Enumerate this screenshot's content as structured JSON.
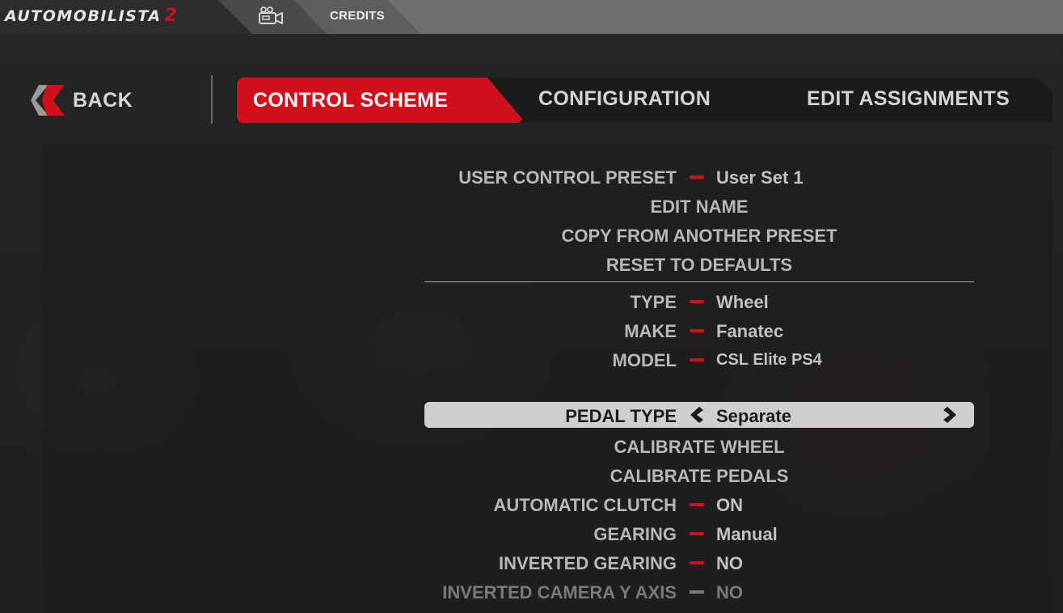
{
  "topbar": {
    "logo_text": "AUTOMOBILISTA",
    "logo_number": "2",
    "camera_icon": "video-camera-icon",
    "credits_label": "CREDITS"
  },
  "nav": {
    "back_label": "BACK",
    "back_icon": "chevron-left-icon",
    "tabs": [
      {
        "label": "CONTROL SCHEME",
        "active": true
      },
      {
        "label": "CONFIGURATION",
        "active": false
      },
      {
        "label": "EDIT ASSIGNMENTS",
        "active": false
      }
    ]
  },
  "settings": {
    "user_control_preset": {
      "label": "USER CONTROL PRESET",
      "value": "User Set 1"
    },
    "edit_name": "EDIT NAME",
    "copy_from_preset": "COPY FROM ANOTHER PRESET",
    "reset_defaults": "RESET TO DEFAULTS",
    "type": {
      "label": "TYPE",
      "value": "Wheel"
    },
    "make": {
      "label": "MAKE",
      "value": "Fanatec"
    },
    "model": {
      "label": "MODEL",
      "value": "CSL Elite PS4"
    },
    "pedal_type": {
      "label": "PEDAL TYPE",
      "value": "Separate"
    },
    "calibrate_wheel": "CALIBRATE WHEEL",
    "calibrate_pedals": "CALIBRATE PEDALS",
    "automatic_clutch": {
      "label": "AUTOMATIC CLUTCH",
      "value": "ON"
    },
    "gearing": {
      "label": "GEARING",
      "value": "Manual"
    },
    "inverted_gearing": {
      "label": "INVERTED GEARING",
      "value": "NO"
    },
    "inverted_camera_y": {
      "label": "INVERTED CAMERA Y AXIS",
      "value": "NO"
    }
  },
  "colors": {
    "accent": "#d0111b",
    "selected_row_bg": "#cfcfcf",
    "text": "#b8b8b8"
  }
}
